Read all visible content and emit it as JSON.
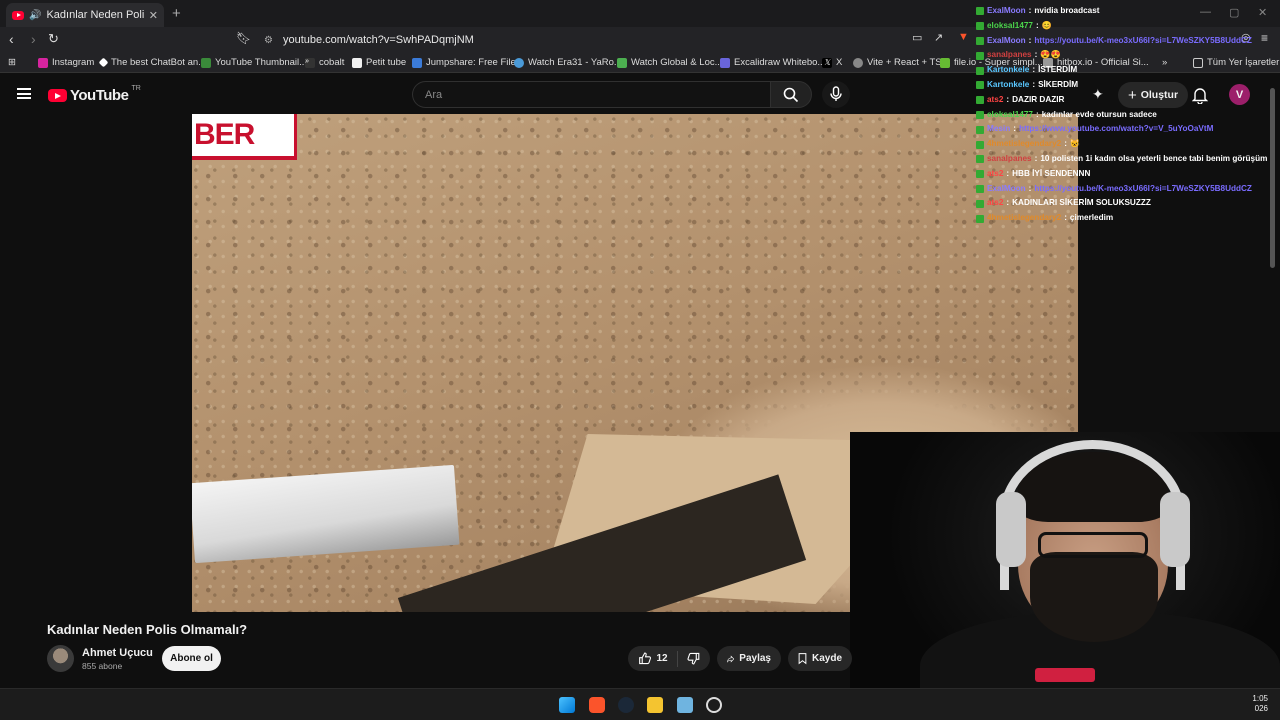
{
  "browser": {
    "tab_title": "Kadınlar Neden Polis Olmamalı?",
    "new_tab": "+",
    "url": "youtube.com/watch?v=SwhPADqmjNM",
    "bookmarks": [
      "Instagram",
      "The best ChatBot an...",
      "YouTube Thumbnail...",
      "cobalt",
      "Petit tube",
      "Jumpshare: Free File...",
      "Watch Era31 - YaRo...",
      "Watch Global & Loc...",
      "Excalidraw Whitebo...",
      "X",
      "Vite + React + TS",
      "file.io - Super simpl...",
      "hitbox.io - Official Si..."
    ],
    "bookmarks_more": "»",
    "all_bookmarks": "Tüm Yer İşaretleri"
  },
  "youtube": {
    "logo_text": "YouTube",
    "region": "TR",
    "search_placeholder": "Ara",
    "create_label": "Oluştur",
    "avatar_letter": "V"
  },
  "video": {
    "overlay_text": "BER",
    "title": "Kadınlar Neden Polis Olmamalı?",
    "channel_name": "Ahmet Uçucu",
    "subscribers": "855 abone",
    "subscribe_label": "Abone ol",
    "likes": "12",
    "share_label": "Paylaş",
    "save_label": "Kayde"
  },
  "chat": [
    {
      "user": "ExalMoon",
      "msg": "nvidia broadcast",
      "user_color": "#8a7bff"
    },
    {
      "user": "eloksal1477",
      "msg": "😊",
      "user_color": "#4cd44c"
    },
    {
      "user": "ExalMoon",
      "msg": "https://youtu.be/K-meo3xU66I?si=L7WeSZKY5B8UddCZ",
      "user_color": "#8a7bff",
      "link": true
    },
    {
      "user": "sanalpanes",
      "msg": "😍😍",
      "user_color": "#d04040"
    },
    {
      "user": "Kartonkele",
      "msg": "İSTERDİM",
      "user_color": "#59c7ff"
    },
    {
      "user": "Kartonkele",
      "msg": "SİKERDİM",
      "user_color": "#59c7ff"
    },
    {
      "user": "ats2",
      "msg": "DAZIR DAZIR",
      "user_color": "#ff4444"
    },
    {
      "user": "eloksal1477",
      "msg": "kadınlar evde otursun sadece",
      "user_color": "#4cd44c"
    },
    {
      "user": "Mesin",
      "msg": "https://www.youtube.com/watch?v=V_5uYoOaVtM",
      "user_color": "#8a7bff",
      "link": true
    },
    {
      "user": "4hmetislegendary2",
      "msg": "😺",
      "user_color": "#e08a2a"
    },
    {
      "user": "sanalpanes",
      "msg": "10 polisten 1i kadın olsa yeterli bence tabi benim görüşüm",
      "user_color": "#d04040"
    },
    {
      "user": "ats2",
      "msg": "HBB İYİ SENDENNN",
      "user_color": "#ff4444"
    },
    {
      "user": "ExalMoon",
      "msg": "https://youtu.be/K-meo3xU66I?si=L7WeSZKY5B8UddCZ",
      "user_color": "#8a7bff",
      "link": true
    },
    {
      "user": "ats2",
      "msg": "KADINLARI SİKERİM SOLUKSUZZZ",
      "user_color": "#ff4444"
    },
    {
      "user": "4hmetislegendary2",
      "msg": "çimerledim",
      "user_color": "#e08a2a"
    }
  ],
  "taskbar": {
    "time": "1:05",
    "date": "026"
  },
  "colors": {
    "youtube_red": "#ff0033",
    "background": "#0f0f0f",
    "chat_link": "#7a6cff"
  }
}
